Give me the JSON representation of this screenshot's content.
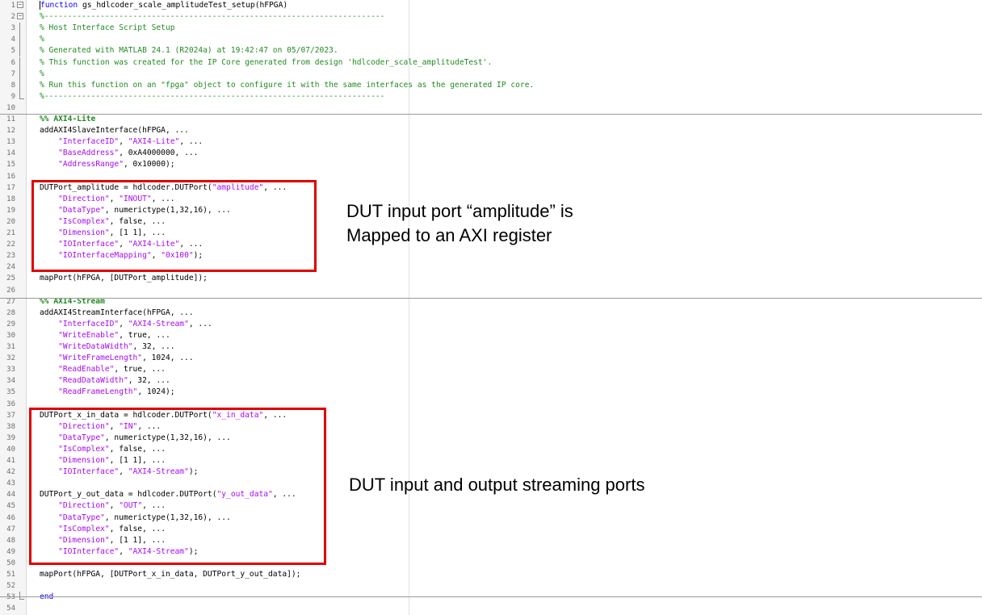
{
  "code_lines": [
    {
      "n": "1",
      "fold": "start",
      "segs": [
        {
          "t": "function",
          "c": "kw"
        },
        {
          "t": " gs_hdlcoder_scale_amplitudeTest_setup(hFPGA)",
          "c": "tx"
        }
      ]
    },
    {
      "n": "2",
      "fold": "start",
      "segs": [
        {
          "t": "%-------------------------------------------------------------------------",
          "c": "cm"
        }
      ]
    },
    {
      "n": "3",
      "fold": "mid",
      "segs": [
        {
          "t": "% Host Interface Script Setup",
          "c": "cm"
        }
      ]
    },
    {
      "n": "4",
      "fold": "mid",
      "segs": [
        {
          "t": "%",
          "c": "cm"
        }
      ]
    },
    {
      "n": "5",
      "fold": "mid",
      "segs": [
        {
          "t": "% Generated with MATLAB 24.1 (R2024a) at 19:42:47 on 05/07/2023.",
          "c": "cm"
        }
      ]
    },
    {
      "n": "6",
      "fold": "mid",
      "segs": [
        {
          "t": "% This function was created for the IP Core generated from design 'hdlcoder_scale_amplitudeTest'.",
          "c": "cm"
        }
      ]
    },
    {
      "n": "7",
      "fold": "mid",
      "segs": [
        {
          "t": "%",
          "c": "cm"
        }
      ]
    },
    {
      "n": "8",
      "fold": "mid",
      "segs": [
        {
          "t": "% Run this function on an \"fpga\" object to configure it with the same interfaces as the generated IP core.",
          "c": "cm"
        }
      ]
    },
    {
      "n": "9",
      "fold": "end",
      "segs": [
        {
          "t": "%-------------------------------------------------------------------------",
          "c": "cm"
        }
      ]
    },
    {
      "n": "10",
      "fold": "",
      "segs": []
    },
    {
      "n": "11",
      "fold": "",
      "segs": [
        {
          "t": "%% AXI4-Lite",
          "c": "sc"
        }
      ]
    },
    {
      "n": "12",
      "fold": "",
      "segs": [
        {
          "t": "addAXI4SlaveInterface(hFPGA, ...",
          "c": "tx"
        }
      ]
    },
    {
      "n": "13",
      "fold": "",
      "segs": [
        {
          "t": "    ",
          "c": "tx"
        },
        {
          "t": "\"InterfaceID\"",
          "c": "st"
        },
        {
          "t": ", ",
          "c": "tx"
        },
        {
          "t": "\"AXI4-Lite\"",
          "c": "st"
        },
        {
          "t": ", ...",
          "c": "tx"
        }
      ]
    },
    {
      "n": "14",
      "fold": "",
      "segs": [
        {
          "t": "    ",
          "c": "tx"
        },
        {
          "t": "\"BaseAddress\"",
          "c": "st"
        },
        {
          "t": ", 0xA4000000, ...",
          "c": "tx"
        }
      ]
    },
    {
      "n": "15",
      "fold": "",
      "segs": [
        {
          "t": "    ",
          "c": "tx"
        },
        {
          "t": "\"AddressRange\"",
          "c": "st"
        },
        {
          "t": ", 0x10000);",
          "c": "tx"
        }
      ]
    },
    {
      "n": "16",
      "fold": "",
      "segs": []
    },
    {
      "n": "17",
      "fold": "",
      "segs": [
        {
          "t": "DUTPort_amplitude = hdlcoder.DUTPort(",
          "c": "tx"
        },
        {
          "t": "\"amplitude\"",
          "c": "st"
        },
        {
          "t": ", ...",
          "c": "tx"
        }
      ]
    },
    {
      "n": "18",
      "fold": "",
      "segs": [
        {
          "t": "    ",
          "c": "tx"
        },
        {
          "t": "\"Direction\"",
          "c": "st"
        },
        {
          "t": ", ",
          "c": "tx"
        },
        {
          "t": "\"INOUT\"",
          "c": "st"
        },
        {
          "t": ", ...",
          "c": "tx"
        }
      ]
    },
    {
      "n": "19",
      "fold": "",
      "segs": [
        {
          "t": "    ",
          "c": "tx"
        },
        {
          "t": "\"DataType\"",
          "c": "st"
        },
        {
          "t": ", numerictype(1,32,16), ...",
          "c": "tx"
        }
      ]
    },
    {
      "n": "20",
      "fold": "",
      "segs": [
        {
          "t": "    ",
          "c": "tx"
        },
        {
          "t": "\"IsComplex\"",
          "c": "st"
        },
        {
          "t": ", false, ...",
          "c": "tx"
        }
      ]
    },
    {
      "n": "21",
      "fold": "",
      "segs": [
        {
          "t": "    ",
          "c": "tx"
        },
        {
          "t": "\"Dimension\"",
          "c": "st"
        },
        {
          "t": ", [1 1], ...",
          "c": "tx"
        }
      ]
    },
    {
      "n": "22",
      "fold": "",
      "segs": [
        {
          "t": "    ",
          "c": "tx"
        },
        {
          "t": "\"IOInterface\"",
          "c": "st"
        },
        {
          "t": ", ",
          "c": "tx"
        },
        {
          "t": "\"AXI4-Lite\"",
          "c": "st"
        },
        {
          "t": ", ...",
          "c": "tx"
        }
      ]
    },
    {
      "n": "23",
      "fold": "",
      "segs": [
        {
          "t": "    ",
          "c": "tx"
        },
        {
          "t": "\"IOInterfaceMapping\"",
          "c": "st"
        },
        {
          "t": ", ",
          "c": "tx"
        },
        {
          "t": "\"0x100\"",
          "c": "st"
        },
        {
          "t": ");",
          "c": "tx"
        }
      ]
    },
    {
      "n": "24",
      "fold": "",
      "segs": []
    },
    {
      "n": "25",
      "fold": "",
      "segs": [
        {
          "t": "mapPort(hFPGA, [DUTPort_amplitude]);",
          "c": "tx"
        }
      ]
    },
    {
      "n": "26",
      "fold": "",
      "segs": []
    },
    {
      "n": "27",
      "fold": "",
      "segs": [
        {
          "t": "%% AXI4-Stream",
          "c": "sc"
        }
      ]
    },
    {
      "n": "28",
      "fold": "",
      "segs": [
        {
          "t": "addAXI4StreamInterface(hFPGA, ...",
          "c": "tx"
        }
      ]
    },
    {
      "n": "29",
      "fold": "",
      "segs": [
        {
          "t": "    ",
          "c": "tx"
        },
        {
          "t": "\"InterfaceID\"",
          "c": "st"
        },
        {
          "t": ", ",
          "c": "tx"
        },
        {
          "t": "\"AXI4-Stream\"",
          "c": "st"
        },
        {
          "t": ", ...",
          "c": "tx"
        }
      ]
    },
    {
      "n": "30",
      "fold": "",
      "segs": [
        {
          "t": "    ",
          "c": "tx"
        },
        {
          "t": "\"WriteEnable\"",
          "c": "st"
        },
        {
          "t": ", true, ...",
          "c": "tx"
        }
      ]
    },
    {
      "n": "31",
      "fold": "",
      "segs": [
        {
          "t": "    ",
          "c": "tx"
        },
        {
          "t": "\"WriteDataWidth\"",
          "c": "st"
        },
        {
          "t": ", 32, ...",
          "c": "tx"
        }
      ]
    },
    {
      "n": "32",
      "fold": "",
      "segs": [
        {
          "t": "    ",
          "c": "tx"
        },
        {
          "t": "\"WriteFrameLength\"",
          "c": "st"
        },
        {
          "t": ", 1024, ...",
          "c": "tx"
        }
      ]
    },
    {
      "n": "33",
      "fold": "",
      "segs": [
        {
          "t": "    ",
          "c": "tx"
        },
        {
          "t": "\"ReadEnable\"",
          "c": "st"
        },
        {
          "t": ", true, ...",
          "c": "tx"
        }
      ]
    },
    {
      "n": "34",
      "fold": "",
      "segs": [
        {
          "t": "    ",
          "c": "tx"
        },
        {
          "t": "\"ReadDataWidth\"",
          "c": "st"
        },
        {
          "t": ", 32, ...",
          "c": "tx"
        }
      ]
    },
    {
      "n": "35",
      "fold": "",
      "segs": [
        {
          "t": "    ",
          "c": "tx"
        },
        {
          "t": "\"ReadFrameLength\"",
          "c": "st"
        },
        {
          "t": ", 1024);",
          "c": "tx"
        }
      ]
    },
    {
      "n": "36",
      "fold": "",
      "segs": []
    },
    {
      "n": "37",
      "fold": "",
      "segs": [
        {
          "t": "DUTPort_x_in_data = hdlcoder.DUTPort(",
          "c": "tx"
        },
        {
          "t": "\"x_in_data\"",
          "c": "st"
        },
        {
          "t": ", ...",
          "c": "tx"
        }
      ]
    },
    {
      "n": "38",
      "fold": "",
      "segs": [
        {
          "t": "    ",
          "c": "tx"
        },
        {
          "t": "\"Direction\"",
          "c": "st"
        },
        {
          "t": ", ",
          "c": "tx"
        },
        {
          "t": "\"IN\"",
          "c": "st"
        },
        {
          "t": ", ...",
          "c": "tx"
        }
      ]
    },
    {
      "n": "39",
      "fold": "",
      "segs": [
        {
          "t": "    ",
          "c": "tx"
        },
        {
          "t": "\"DataType\"",
          "c": "st"
        },
        {
          "t": ", numerictype(1,32,16), ...",
          "c": "tx"
        }
      ]
    },
    {
      "n": "40",
      "fold": "",
      "segs": [
        {
          "t": "    ",
          "c": "tx"
        },
        {
          "t": "\"IsComplex\"",
          "c": "st"
        },
        {
          "t": ", false, ...",
          "c": "tx"
        }
      ]
    },
    {
      "n": "41",
      "fold": "",
      "segs": [
        {
          "t": "    ",
          "c": "tx"
        },
        {
          "t": "\"Dimension\"",
          "c": "st"
        },
        {
          "t": ", [1 1], ...",
          "c": "tx"
        }
      ]
    },
    {
      "n": "42",
      "fold": "",
      "segs": [
        {
          "t": "    ",
          "c": "tx"
        },
        {
          "t": "\"IOInterface\"",
          "c": "st"
        },
        {
          "t": ", ",
          "c": "tx"
        },
        {
          "t": "\"AXI4-Stream\"",
          "c": "st"
        },
        {
          "t": ");",
          "c": "tx"
        }
      ]
    },
    {
      "n": "43",
      "fold": "",
      "segs": []
    },
    {
      "n": "44",
      "fold": "",
      "segs": [
        {
          "t": "DUTPort_y_out_data = hdlcoder.DUTPort(",
          "c": "tx"
        },
        {
          "t": "\"y_out_data\"",
          "c": "st"
        },
        {
          "t": ", ...",
          "c": "tx"
        }
      ]
    },
    {
      "n": "45",
      "fold": "",
      "segs": [
        {
          "t": "    ",
          "c": "tx"
        },
        {
          "t": "\"Direction\"",
          "c": "st"
        },
        {
          "t": ", ",
          "c": "tx"
        },
        {
          "t": "\"OUT\"",
          "c": "st"
        },
        {
          "t": ", ...",
          "c": "tx"
        }
      ]
    },
    {
      "n": "46",
      "fold": "",
      "segs": [
        {
          "t": "    ",
          "c": "tx"
        },
        {
          "t": "\"DataType\"",
          "c": "st"
        },
        {
          "t": ", numerictype(1,32,16), ...",
          "c": "tx"
        }
      ]
    },
    {
      "n": "47",
      "fold": "",
      "segs": [
        {
          "t": "    ",
          "c": "tx"
        },
        {
          "t": "\"IsComplex\"",
          "c": "st"
        },
        {
          "t": ", false, ...",
          "c": "tx"
        }
      ]
    },
    {
      "n": "48",
      "fold": "",
      "segs": [
        {
          "t": "    ",
          "c": "tx"
        },
        {
          "t": "\"Dimension\"",
          "c": "st"
        },
        {
          "t": ", [1 1], ...",
          "c": "tx"
        }
      ]
    },
    {
      "n": "49",
      "fold": "",
      "segs": [
        {
          "t": "    ",
          "c": "tx"
        },
        {
          "t": "\"IOInterface\"",
          "c": "st"
        },
        {
          "t": ", ",
          "c": "tx"
        },
        {
          "t": "\"AXI4-Stream\"",
          "c": "st"
        },
        {
          "t": ");",
          "c": "tx"
        }
      ]
    },
    {
      "n": "50",
      "fold": "",
      "segs": []
    },
    {
      "n": "51",
      "fold": "",
      "segs": [
        {
          "t": "mapPort(hFPGA, [DUTPort_x_in_data, DUTPort_y_out_data]);",
          "c": "tx"
        }
      ]
    },
    {
      "n": "52",
      "fold": "",
      "segs": []
    },
    {
      "n": "53",
      "fold": "endfn",
      "segs": [
        {
          "t": "end",
          "c": "kw"
        }
      ]
    },
    {
      "n": "54",
      "fold": "",
      "segs": []
    }
  ],
  "annotations": {
    "amplitude_line1": "DUT input port “amplitude” is",
    "amplitude_line2": "Mapped to an AXI register",
    "streaming": "DUT input and output streaming ports"
  },
  "colors": {
    "keyword": "#0e00ff",
    "comment": "#228b22",
    "string": "#a709f5",
    "highlight_box": "#e00000"
  }
}
